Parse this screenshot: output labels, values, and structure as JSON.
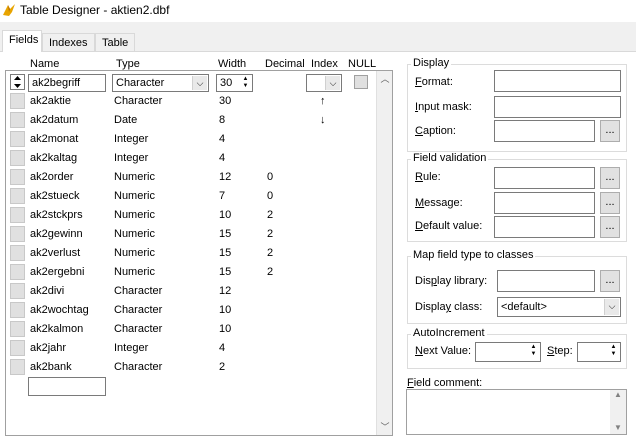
{
  "window": {
    "title": "Table Designer - aktien2.dbf"
  },
  "tabs": [
    {
      "label": "Fields",
      "active": true
    },
    {
      "label": "Indexes",
      "active": false
    },
    {
      "label": "Table",
      "active": false
    }
  ],
  "grid": {
    "headers": {
      "name": "Name",
      "type": "Type",
      "width": "Width",
      "decimal": "Decimal",
      "index": "Index",
      "null": "NULL"
    },
    "current_row": {
      "name": "ak2begriff",
      "type": "Character",
      "width": "30",
      "index": "",
      "null_checked": false
    },
    "rows": [
      {
        "name": "ak2aktie",
        "type": "Character",
        "width": "30",
        "decimal": "",
        "index": "↑"
      },
      {
        "name": "ak2datum",
        "type": "Date",
        "width": "8",
        "decimal": "",
        "index": "↓"
      },
      {
        "name": "ak2monat",
        "type": "Integer",
        "width": "4",
        "decimal": "",
        "index": ""
      },
      {
        "name": "ak2kaltag",
        "type": "Integer",
        "width": "4",
        "decimal": "",
        "index": ""
      },
      {
        "name": "ak2order",
        "type": "Numeric",
        "width": "12",
        "decimal": "0",
        "index": ""
      },
      {
        "name": "ak2stueck",
        "type": "Numeric",
        "width": "7",
        "decimal": "0",
        "index": ""
      },
      {
        "name": "ak2stckprs",
        "type": "Numeric",
        "width": "10",
        "decimal": "2",
        "index": ""
      },
      {
        "name": "ak2gewinn",
        "type": "Numeric",
        "width": "15",
        "decimal": "2",
        "index": ""
      },
      {
        "name": "ak2verlust",
        "type": "Numeric",
        "width": "15",
        "decimal": "2",
        "index": ""
      },
      {
        "name": "ak2ergebni",
        "type": "Numeric",
        "width": "15",
        "decimal": "2",
        "index": ""
      },
      {
        "name": "ak2divi",
        "type": "Character",
        "width": "12",
        "decimal": "",
        "index": ""
      },
      {
        "name": "ak2wochtag",
        "type": "Character",
        "width": "10",
        "decimal": "",
        "index": ""
      },
      {
        "name": "ak2kalmon",
        "type": "Character",
        "width": "10",
        "decimal": "",
        "index": ""
      },
      {
        "name": "ak2jahr",
        "type": "Integer",
        "width": "4",
        "decimal": "",
        "index": ""
      },
      {
        "name": "ak2bank",
        "type": "Character",
        "width": "2",
        "decimal": "",
        "index": ""
      }
    ],
    "new_name_value": ""
  },
  "display": {
    "title": "Display",
    "format_label": "Format:",
    "format_value": "",
    "input_mask_label": "Input mask:",
    "input_mask_value": "",
    "caption_label": "Caption:",
    "caption_value": "",
    "dots": "..."
  },
  "validation": {
    "title": "Field validation",
    "rule_label": "Rule:",
    "rule_value": "",
    "message_label": "Message:",
    "message_value": "",
    "default_label": "Default value:",
    "default_value": ""
  },
  "map": {
    "title": "Map field type to classes",
    "library_label": "Display library:",
    "library_value": "",
    "class_label": "Display class:",
    "class_value": "<default>"
  },
  "autoinc": {
    "title": "AutoIncrement",
    "next_label": "Next Value:",
    "next_value": "",
    "step_label": "Step:",
    "step_value": ""
  },
  "comment": {
    "label": "Field comment:",
    "value": ""
  }
}
